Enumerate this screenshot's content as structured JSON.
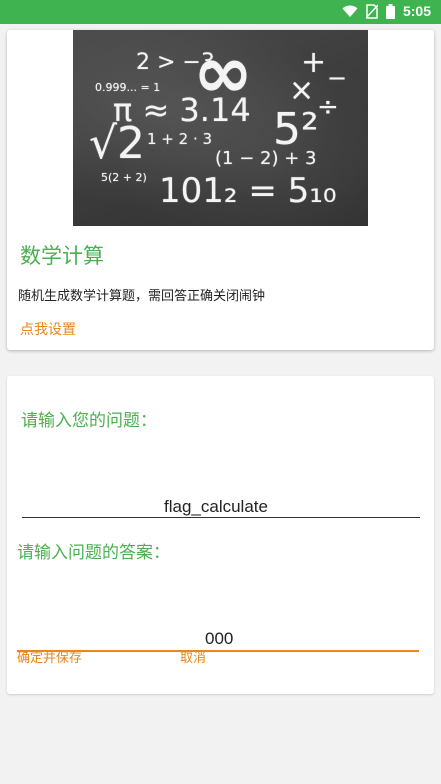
{
  "status_bar": {
    "time": "5:05",
    "icons": [
      "wifi-icon",
      "no-sim-icon",
      "battery-icon"
    ],
    "color": "#3eb34f"
  },
  "feature_card": {
    "hero_image": {
      "formulas": [
        "2 > −3",
        "∞",
        "+",
        "−",
        "×",
        "÷",
        "0.999... = 1",
        "π ≈ 3.14",
        "√2",
        "5²",
        "1 + 2 · 3",
        "(1 − 2) + 3",
        "5(2 + 2)",
        "101₂ = 5₁₀"
      ]
    },
    "title": "数学计算",
    "description": "随机生成数学计算题，需回答正确关闭闹钟",
    "settings_link": "点我设置"
  },
  "form_card": {
    "question_label": "请输入您的问题：",
    "question_value": "flag_calculate",
    "answer_label": "请输入问题的答案：",
    "answer_value": "000",
    "confirm_button": "确定并保存",
    "cancel_button": "取消"
  },
  "colors": {
    "accent_green": "#4caf50",
    "accent_orange": "#e8871e",
    "status_green": "#3eb34f",
    "input_focus_orange": "#e8871e"
  }
}
